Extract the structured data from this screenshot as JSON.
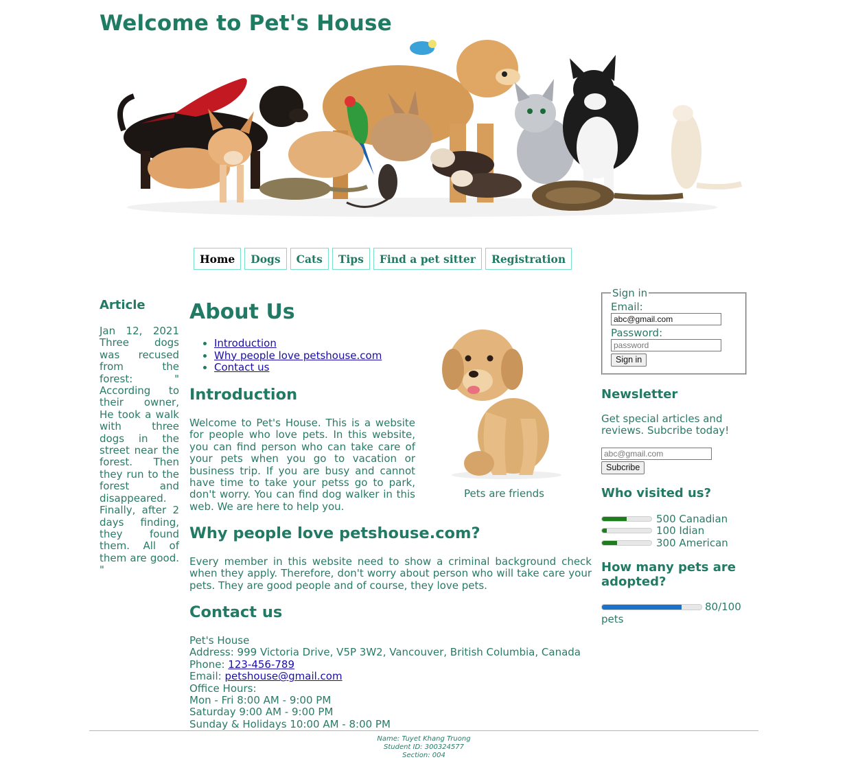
{
  "header": {
    "title": "Welcome to Pet's House"
  },
  "nav": {
    "items": [
      {
        "label": "Home",
        "active": true
      },
      {
        "label": "Dogs"
      },
      {
        "label": "Cats"
      },
      {
        "label": "Tips"
      },
      {
        "label": "Find a pet sitter"
      },
      {
        "label": "Registration"
      }
    ]
  },
  "article": {
    "heading": "Article",
    "date": "Jan 12, 2021",
    "headline": "Three dogs was recused from the forest:",
    "quote": "\" According to their owner, He took a walk with three dogs in the street near the forest. Then they run to the forest and disappeared. Finally, after 2 days finding, they found them. All of them are good. \""
  },
  "main": {
    "title": "About Us",
    "toc": [
      "Introduction",
      "Why people love petshouse.com",
      "Contact us"
    ],
    "intro": {
      "heading": "Introduction",
      "text": "Welcome to Pet's House. This is a website for people who love pets. In this website, you can find person who can take care of your pets when you go to vacation or business trip. If you are busy and cannot have time to take your petss go to park, don't worry. You can find dog walker in this web. We are here to help you."
    },
    "figure_caption": "Pets are friends",
    "why": {
      "heading": "Why people love petshouse.com?",
      "text": "Every member in this website need to show a criminal background check when they apply. Therefore, don't worry about person who will take care your pets. They are good people and of course, they love pets."
    },
    "contact": {
      "heading": "Contact us",
      "name": "Pet's House",
      "address": "Address: 999 Victoria Drive, V5P 3W2, Vancouver, British Columbia, Canada",
      "phone_label": "Phone: ",
      "phone": "123-456-789",
      "email_label": "Email: ",
      "email": "petshouse@gmail.com",
      "hours_label": "Office Hours:",
      "hours": [
        "Mon - Fri 8:00 AM - 9:00 PM",
        "Saturday 9:00 AM - 9:00 PM",
        "Sunday & Holidays 10:00 AM - 8:00 PM"
      ]
    }
  },
  "signin": {
    "legend": "Sign in",
    "email_label": "Email:",
    "email_value": "abc@gmail.com",
    "password_label": "Password:",
    "password_placeholder": "password",
    "button": "Sign in"
  },
  "newsletter": {
    "heading": "Newsletter",
    "text": "Get special articles and reviews. Subcribe today!",
    "email_placeholder": "abc@gmail.com",
    "button": "Subcribe"
  },
  "visitors": {
    "heading": "Who visited us?",
    "rows": [
      {
        "label": "500 Canadian",
        "level": 0.5
      },
      {
        "label": "100 Idian",
        "level": 0.1
      },
      {
        "label": "300 American",
        "level": 0.3
      }
    ]
  },
  "adoption": {
    "heading": "How many pets are adopted?",
    "value": 80,
    "max": 100,
    "text": "80/100",
    "unit": "pets"
  },
  "footer": {
    "name": "Name: Tuyet Khang Truong",
    "student_id": "Student ID: 300324577",
    "section": "Section: 004"
  },
  "colors": {
    "accent": "#227a64",
    "nav_border": "#77e0c9",
    "link": "#1a0dab",
    "meter": "#1e7d1e",
    "progress": "#1a73c9"
  }
}
